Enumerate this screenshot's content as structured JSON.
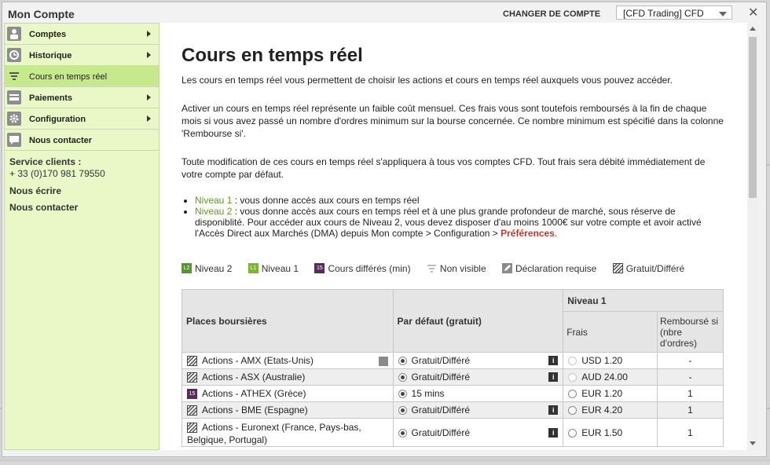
{
  "header": {
    "title": "Mon Compte",
    "switch_label": "CHANGER DE COMPTE",
    "account_selected": "[CFD Trading]  CFD",
    "close_glyph": "✕"
  },
  "sidebar": {
    "items": [
      {
        "label": "Comptes",
        "icon": "person-icon",
        "arrow": true,
        "active": false
      },
      {
        "label": "Historique",
        "icon": "history-icon",
        "arrow": true,
        "active": false
      },
      {
        "label": "Cours en temps réel",
        "icon": "filter-icon",
        "arrow": false,
        "active": true
      },
      {
        "label": "Paiements",
        "icon": "card-icon",
        "arrow": true,
        "active": false
      },
      {
        "label": "Configuration",
        "icon": "gear-icon",
        "arrow": true,
        "active": false
      },
      {
        "label": "Nous contacter",
        "icon": "chat-icon",
        "arrow": false,
        "active": false
      }
    ],
    "service_label": "Service clients :",
    "phone": "+ 33 (0)170 981 79550",
    "write_link": "Nous écrire",
    "contact_link": "Nous contacter"
  },
  "main": {
    "title": "Cours en temps réel",
    "intro": "Les cours en temps réel vous permettent de choisir les actions et cours en temps réel auxquels vous pouvez accéder.",
    "para2": "Activer un cours en temps réel représente un faible coût mensuel. Ces frais vous sont toutefois remboursés à la fin de chaque mois si vous avez passé un nombre d'ordres minimum sur la bourse concernée. Ce nombre minimum est spécifié dans la colonne 'Rembourse si'.",
    "para3": "Toute modification de ces cours en temps réel s'appliquera à tous vos comptes CFD. Tout frais sera débité immédiatement de votre compte par défaut.",
    "level1_name": "Niveau 1",
    "level1_text": " : vous donne accès aux cours en temps réel",
    "level2_name": "Niveau 2",
    "level2_text": " : vous donne accès aux cours en temps réel et à une plus grande profondeur de marché, sous réserve de disponiblité. Pour accéder aux cours de Niveau 2, vous devez disposer d'au moins 1000€ sur votre compte et avoir activé l'Accès Direct aux Marchés (DMA) depuis Mon compte > Configuration > ",
    "preferences_link": "Préférences",
    "period": "."
  },
  "legend": {
    "l2_badge": "L2",
    "l2": "Niveau 2",
    "l1_badge": "L1",
    "l1": "Niveau 1",
    "delayed_badge": "15",
    "delayed": "Cours différés (min)",
    "notvisible": "Non visible",
    "declaration": "Déclaration requise",
    "free": "Gratuit/Différé"
  },
  "table": {
    "col_market": "Places boursières",
    "col_default": "Par défaut (gratuit)",
    "col_level1": "Niveau 1",
    "col_fees": "Frais",
    "col_refund": "Remboursé si (nbre d'ordres)",
    "rows": [
      {
        "market": "Actions - AMX (Etats-Unis)",
        "badge": "free",
        "edit": true,
        "default": "Gratuit/Différé",
        "info": true,
        "fee": "USD 1.20",
        "fee_enabled": false,
        "refund": "-"
      },
      {
        "market": "Actions - ASX (Australie)",
        "badge": "free",
        "edit": false,
        "default": "Gratuit/Différé",
        "info": true,
        "fee": "AUD 24.00",
        "fee_enabled": false,
        "refund": "-"
      },
      {
        "market": "Actions - ATHEX (Grèce)",
        "badge": "15",
        "edit": false,
        "default": "15 mins",
        "info": false,
        "fee": "EUR 1.20",
        "fee_enabled": true,
        "refund": "1"
      },
      {
        "market": "Actions - BME (Espagne)",
        "badge": "free",
        "edit": false,
        "default": "Gratuit/Différé",
        "info": true,
        "fee": "EUR 4.20",
        "fee_enabled": true,
        "refund": "1"
      },
      {
        "market": "Actions - Euronext (France, Pays-bas, Belgique, Portugal)",
        "badge": "free",
        "edit": false,
        "default": "Gratuit/Différé",
        "info": true,
        "fee": "EUR 1.50",
        "fee_enabled": true,
        "refund": "1"
      }
    ]
  }
}
